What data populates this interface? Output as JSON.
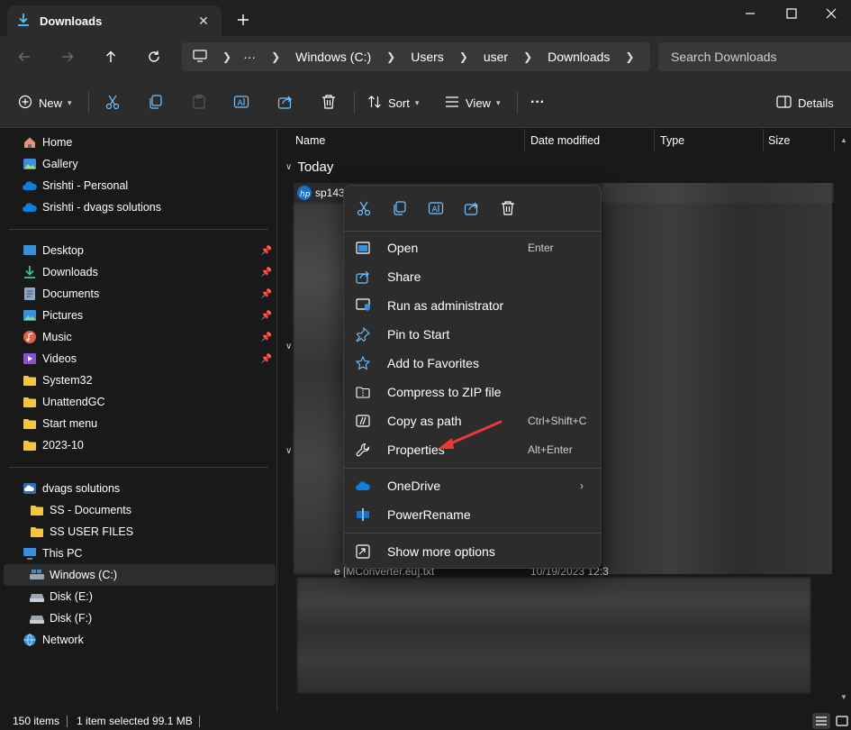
{
  "window": {
    "tab_title": "Downloads",
    "colors": {
      "accent": "#4cc2ff",
      "folder": "#f8c63d",
      "onedrive": "#0f7fdc",
      "annotation_arrow": "#e83a3a"
    }
  },
  "address": {
    "crumbs": [
      "Windows (C:)",
      "Users",
      "user",
      "Downloads"
    ],
    "ellipsis": "···",
    "search_placeholder": "Search Downloads"
  },
  "commands": {
    "new": "New",
    "sort": "Sort",
    "view": "View",
    "more": "···",
    "details": "Details"
  },
  "sidebar": {
    "top": [
      {
        "label": "Home",
        "icon": "home-icon"
      },
      {
        "label": "Gallery",
        "icon": "gallery-icon"
      },
      {
        "label": "Srishti - Personal",
        "icon": "onedrive-icon"
      },
      {
        "label": "Srishti - dvags solutions",
        "icon": "onedrive-icon"
      }
    ],
    "quick": [
      {
        "label": "Desktop",
        "icon": "desktop-icon",
        "pinned": true
      },
      {
        "label": "Downloads",
        "icon": "download-icon",
        "pinned": true
      },
      {
        "label": "Documents",
        "icon": "documents-icon",
        "pinned": true
      },
      {
        "label": "Pictures",
        "icon": "pictures-icon",
        "pinned": true
      },
      {
        "label": "Music",
        "icon": "music-icon",
        "pinned": true
      },
      {
        "label": "Videos",
        "icon": "videos-icon",
        "pinned": true
      },
      {
        "label": "System32",
        "icon": "folder-icon",
        "pinned": false
      },
      {
        "label": "UnattendGC",
        "icon": "folder-icon",
        "pinned": false
      },
      {
        "label": "Start menu",
        "icon": "folder-icon",
        "pinned": false
      },
      {
        "label": "2023-10",
        "icon": "folder-icon",
        "pinned": false
      }
    ],
    "tree": [
      {
        "label": "dvags solutions",
        "icon": "onedrive-icon"
      },
      {
        "label": "SS - Documents",
        "icon": "folder-icon"
      },
      {
        "label": "SS USER FILES",
        "icon": "folder-icon"
      },
      {
        "label": "This PC",
        "icon": "pc-icon"
      },
      {
        "label": "Windows (C:)",
        "icon": "drive-icon",
        "selected": true
      },
      {
        "label": "Disk (E:)",
        "icon": "drive-icon"
      },
      {
        "label": "Disk (F:)",
        "icon": "drive-icon"
      },
      {
        "label": "Network",
        "icon": "network-icon"
      }
    ]
  },
  "filelist": {
    "columns": [
      "Name",
      "Date modified",
      "Type",
      "Size"
    ],
    "group": "Today",
    "first_row_name": "sp1430",
    "last_row_name": "e [MConverter.eu].txt",
    "last_row_date": "10/19/2023 12:3"
  },
  "context_menu": {
    "items": [
      {
        "label": "Open",
        "shortcut": "Enter",
        "icon": "open-icon"
      },
      {
        "label": "Share",
        "shortcut": "",
        "icon": "share-icon"
      },
      {
        "label": "Run as administrator",
        "shortcut": "",
        "icon": "shield-icon"
      },
      {
        "label": "Pin to Start",
        "shortcut": "",
        "icon": "pin-icon"
      },
      {
        "label": "Add to Favorites",
        "shortcut": "",
        "icon": "star-icon"
      },
      {
        "label": "Compress to ZIP file",
        "shortcut": "",
        "icon": "zip-icon"
      },
      {
        "label": "Copy as path",
        "shortcut": "Ctrl+Shift+C",
        "icon": "path-icon"
      },
      {
        "label": "Properties",
        "shortcut": "Alt+Enter",
        "icon": "wrench-icon"
      }
    ],
    "extra": [
      {
        "label": "OneDrive",
        "icon": "onedrive-icon"
      },
      {
        "label": "PowerRename",
        "icon": "powerrename-icon"
      }
    ],
    "more": {
      "label": "Show more options",
      "icon": "more-options-icon"
    }
  },
  "status": {
    "count": "150 items",
    "selection": "1 item selected  99.1 MB"
  }
}
